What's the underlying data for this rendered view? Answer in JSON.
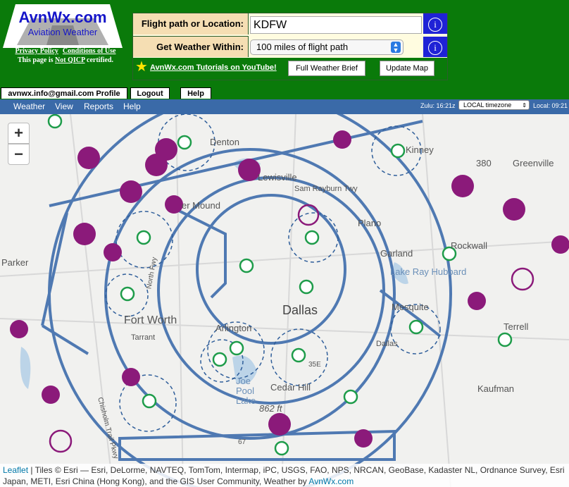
{
  "header": {
    "logo_title": "AvnWx.com",
    "logo_subtitle": "Aviation Weather",
    "privacy_link": "Privacy Policy",
    "terms_link": "Conditions of Use",
    "qicp_prefix": "This page is ",
    "qicp_link": "Not QICP",
    "qicp_suffix": " certified."
  },
  "controls": {
    "location_label": "Flight path or Location:",
    "location_value": "KDFW",
    "within_label": "Get Weather Within:",
    "within_value": "100 miles of flight path",
    "info_icon": "info-icon",
    "tutorials_link": "AvnWx.com Tutorials on YouTube!",
    "brief_button": "Full Weather Brief",
    "update_button": "Update Map"
  },
  "account": {
    "email": "avnwx.info@gmail.com Profile",
    "logout": "Logout",
    "help": "Help"
  },
  "menu": {
    "items": [
      "Weather",
      "View",
      "Reports",
      "Help"
    ],
    "zulu": "Zulu: 16:21z",
    "timezone": "LOCAL timezone",
    "local": "Local: 09:21"
  },
  "map": {
    "zoom_in": "+",
    "zoom_out": "−",
    "places": {
      "denton": "Denton",
      "kinney": "Kinney",
      "greenville": "Greenville",
      "lewisville": "Lewisville",
      "flower_mound": "er Mound",
      "sam_rayburn": "Sam Rayburn Twy",
      "plano": "Plano",
      "garland": "Garland",
      "rockwall": "Rockwall",
      "parker": "Parker",
      "lake_ray_hubbard": "Lake Ray Hubbard",
      "dallas": "Dallas",
      "fort_worth": "Fort Worth",
      "tarrant": "Tarrant",
      "mesquite": "Mesquite",
      "terrell": "Terrell",
      "arlington": "Arlington",
      "dallas_county": "Dallas",
      "joe_pool_lake": "Joe Pool Lake",
      "cedar_hill": "Cedar Hill",
      "kaufman": "Kaufman",
      "elevation": "862 ft",
      "road_380": "380",
      "north_fwy": "North Fwy",
      "chisholm": "Chisholm Trail Pkwy",
      "road_67": "67",
      "road_35e": "35E"
    },
    "colors": {
      "airspace": "#4f79b2",
      "metar_purple": "#8b1a7a",
      "airport_green": "#1e9c4a"
    }
  },
  "attribution": {
    "leaflet": "Leaflet",
    "text": " | Tiles © Esri — Esri, DeLorme, NAVTEQ, TomTom, Intermap, iPC, USGS, FAO, NPS, NRCAN, GeoBase, Kadaster NL, Ordnance Survey, Esri Japan, METI, Esri China (Hong Kong), and the GIS User Community, Weather by ",
    "avnwx": "AvnWx.com"
  }
}
